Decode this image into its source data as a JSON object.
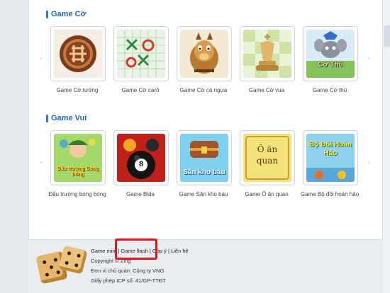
{
  "sections": [
    {
      "title": "Game Cờ",
      "games": [
        {
          "name": "Game Cờ tướng",
          "icon": "xiangqi-icon"
        },
        {
          "name": "Game Cờ carô",
          "icon": "tic-tac-toe-icon"
        },
        {
          "name": "Game Cờ cá ngựa",
          "icon": "horse-icon"
        },
        {
          "name": "Game Cờ vua",
          "icon": "chess-king-icon"
        },
        {
          "name": "Game Cờ thú",
          "icon": "animal-chess-icon",
          "art_text": "Cờ Thú"
        }
      ]
    },
    {
      "title": "Game Vui",
      "games": [
        {
          "name": "Đấu trường bong bóng",
          "icon": "bubble-arena-icon",
          "art_text": "Đấu trường Bong bóng"
        },
        {
          "name": "Game Bida",
          "icon": "billiard-ball-icon",
          "art_text": "8"
        },
        {
          "name": "Game Săn kho báu",
          "icon": "treasure-chest-icon",
          "art_text": "Săn kho báu"
        },
        {
          "name": "Game Ô ăn quan",
          "icon": "o-an-quan-icon",
          "art_text": "Ô ăn quan"
        },
        {
          "name": "Game Bộ đôi hoàn hảo",
          "icon": "perfect-pair-icon",
          "art_text": "Bộ Đôi Hoàn Hảo"
        }
      ]
    }
  ],
  "footer": {
    "links": [
      "Game mini",
      "Game flash",
      "Góp ý",
      "Liên hệ"
    ],
    "separator": "|",
    "copyright": "Copyright © Zing",
    "operator": "Đơn vị chủ quản: Công ty VNG",
    "license": "Giấy phép ICP số: 41/GP-TTĐT",
    "logo_icon": "dice-icon"
  },
  "colors": {
    "section_title": "#1f66c2",
    "highlight_box": "#e0181b"
  }
}
